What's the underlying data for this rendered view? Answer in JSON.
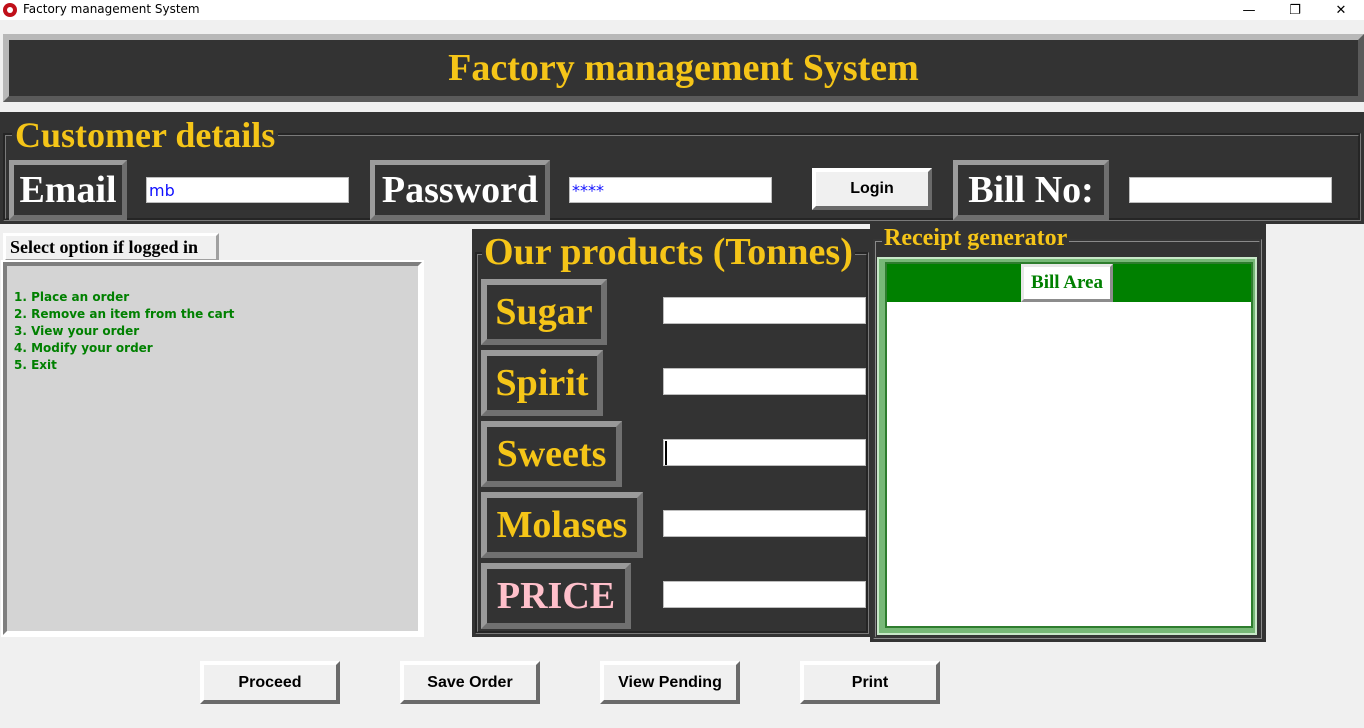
{
  "window": {
    "title": "Factory management System",
    "minimize_glyph": "—",
    "maximize_glyph": "❐",
    "close_glyph": "✕"
  },
  "header": {
    "title": "Factory management System"
  },
  "customer": {
    "legend": "Customer details",
    "email_label": "Email",
    "email_value": "mb",
    "password_label": "Password",
    "password_value": "****",
    "login_label": "Login",
    "bill_label": "Bill No:",
    "bill_value": ""
  },
  "menu": {
    "title": "Select option if logged in",
    "items": [
      "1. Place an order",
      "2. Remove an item from the cart",
      "3. View your order",
      "4. Modify your order",
      "5. Exit"
    ]
  },
  "products": {
    "legend": "Our products (Tonnes)",
    "items": [
      {
        "label": "Sugar",
        "value": ""
      },
      {
        "label": "Spirit",
        "value": ""
      },
      {
        "label": "Sweets",
        "value": ""
      },
      {
        "label": "Molases",
        "value": ""
      },
      {
        "label": "PRICE",
        "value": ""
      }
    ]
  },
  "receipt": {
    "legend": "Receipt generator",
    "bill_area_label": "Bill Area",
    "content": ""
  },
  "actions": {
    "proceed": "Proceed",
    "save_order": "Save Order",
    "view_pending": "View Pending",
    "print": "Print"
  },
  "colors": {
    "accent_yellow": "#f5c518",
    "panel_dark": "#333333",
    "menu_text_green": "#008000",
    "price_pink": "#ffc0cb",
    "input_text_blue": "#1010ff"
  }
}
